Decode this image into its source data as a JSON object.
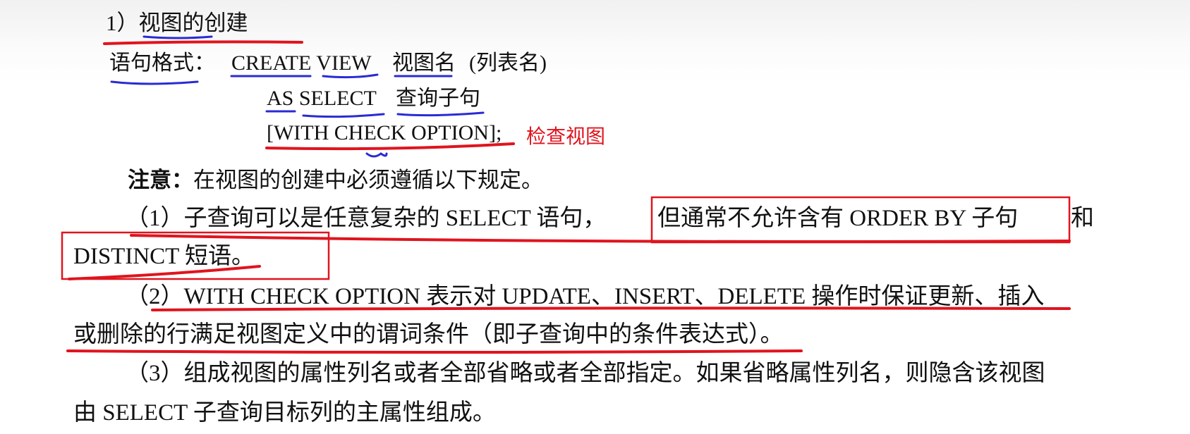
{
  "heading": "1）视图的创建",
  "syntax": {
    "label": "语句格式：",
    "line1_kw": "CREATE VIEW",
    "line1_name": "视图名",
    "line1_cols": "(列表名)",
    "line2_kw": "AS SELECT",
    "line2_sub": "查询子句",
    "line3": "[WITH CHECK OPTION];",
    "note_annotation": "检查视图"
  },
  "note": {
    "label": "注意：",
    "text": "在视图的创建中必须遵循以下规定。"
  },
  "rules": [
    {
      "line1_a": "（1）子查询可以是任意复杂的  SELECT  语句，",
      "line1_b": "但通常不允许含有  ORDER  BY  子句",
      "line1_c": "和",
      "line2": "DISTINCT 短语。"
    },
    {
      "line1": "（2）WITH CHECK OPTION 表示对 UPDATE、INSERT、DELETE 操作时保证更新、插入",
      "line2": "或删除的行满足视图定义中的谓词条件（即子查询中的条件表达式）。"
    },
    {
      "line1": "（3）组成视图的属性列名或者全部省略或者全部指定。如果省略属性列名，则隐含该视图",
      "line2": "由 SELECT 子查询目标列的主属性组成。"
    }
  ],
  "colors": {
    "red_ink": "#e0141e",
    "blue_ink": "#2a2ad6"
  }
}
